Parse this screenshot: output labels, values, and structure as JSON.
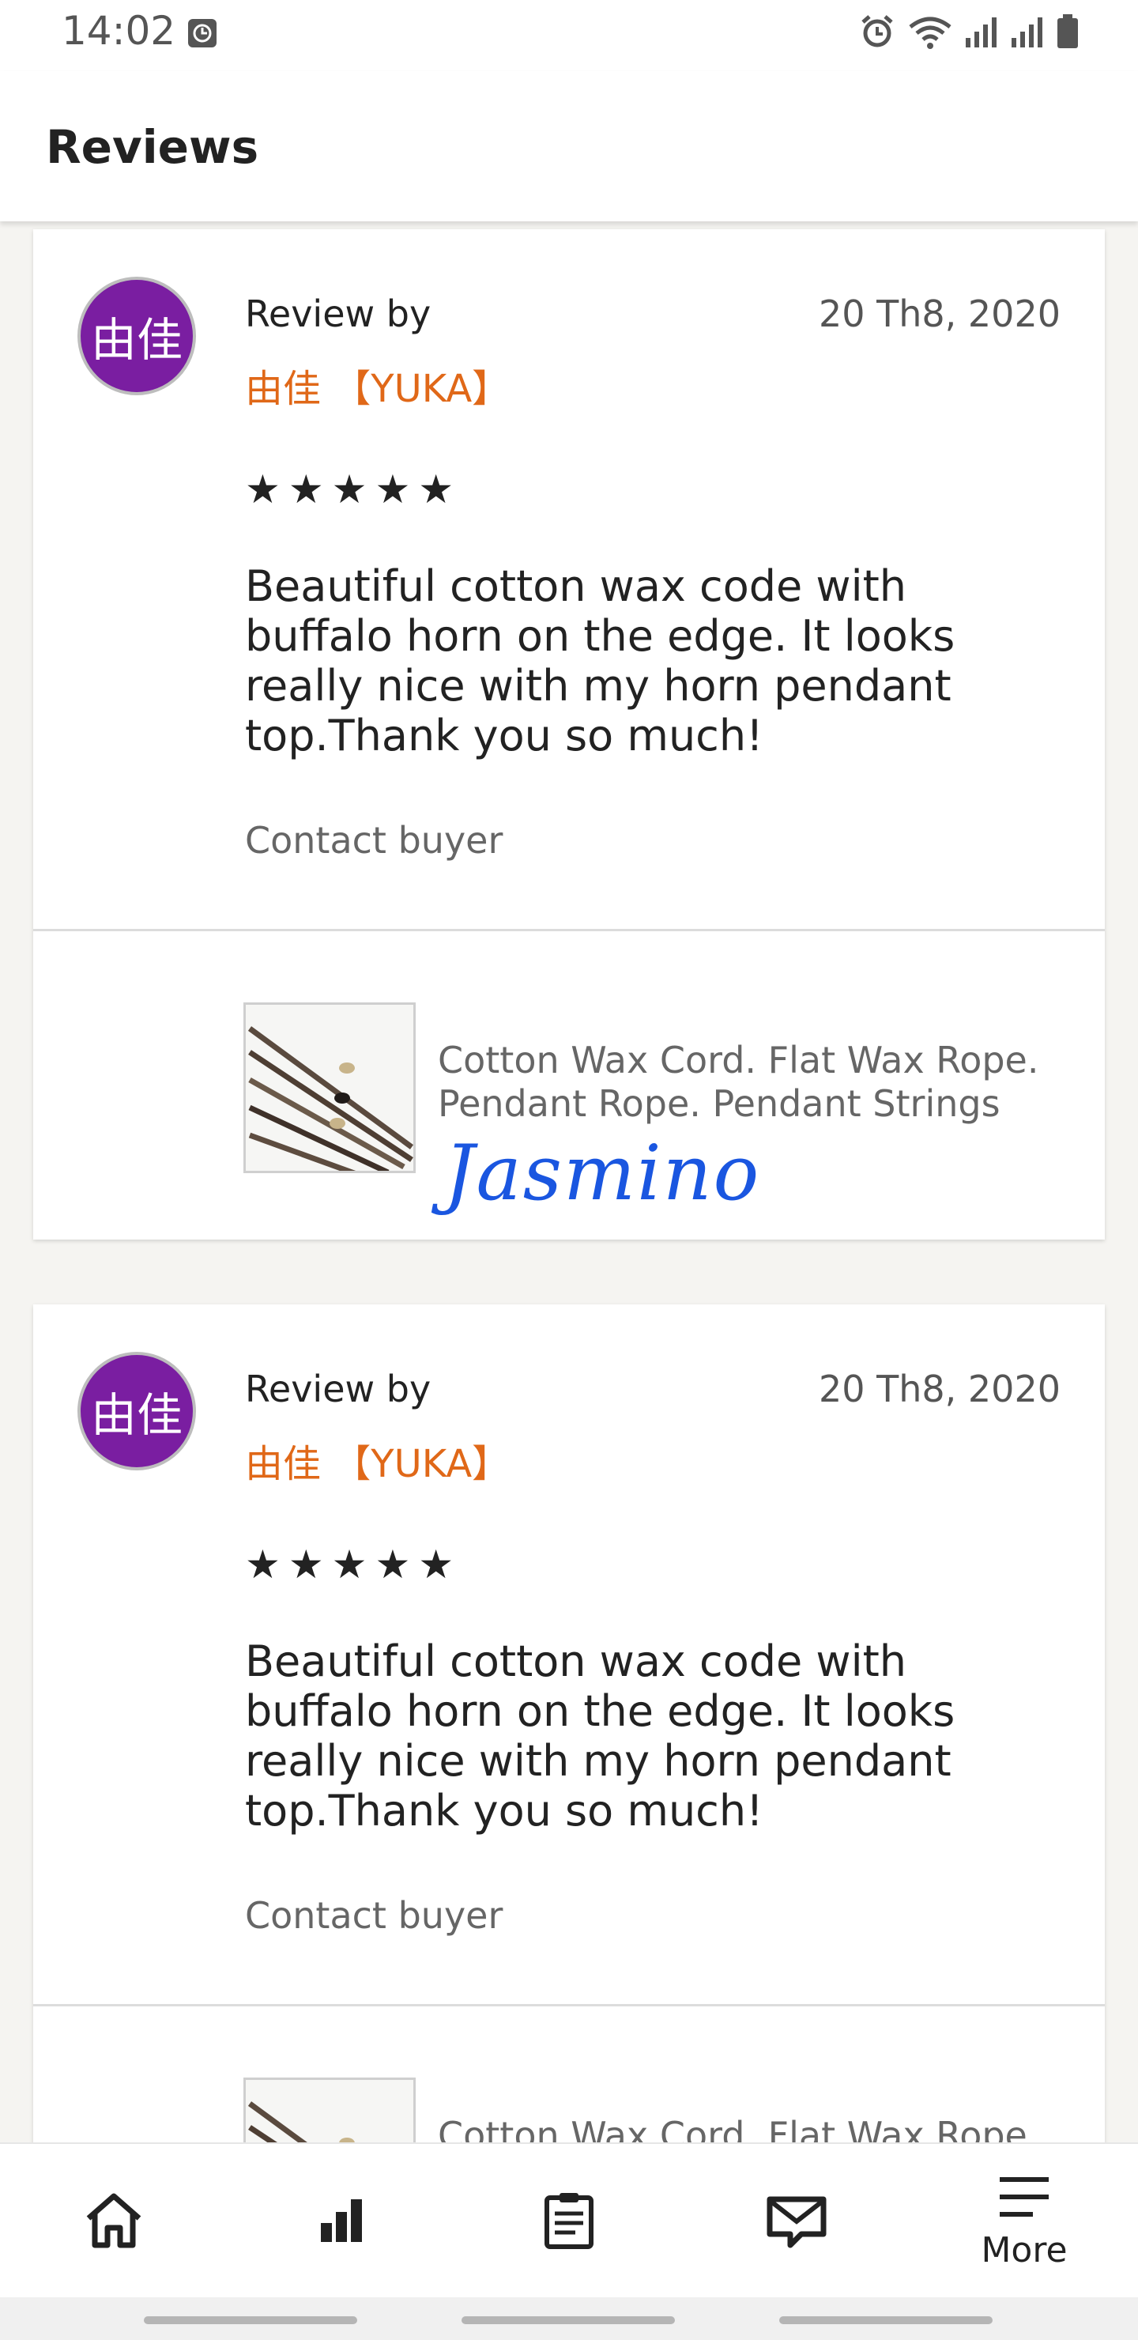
{
  "status_bar": {
    "time": "14:02"
  },
  "header": {
    "title": "Reviews"
  },
  "reviews": [
    {
      "review_by_label": "Review by",
      "avatar_text": "由佳",
      "reviewer": "由佳 【YUKA】",
      "date": "20 Th8, 2020",
      "stars": "★★★★★",
      "rating": 5,
      "text": "Beautiful cotton wax code with buffalo horn on the edge. It looks really nice with my horn pendant top.Thank you so much!",
      "contact_label": "Contact buyer",
      "product_title": "Cotton Wax Cord. Flat Wax Rope. Pendant Rope. Pendant Strings",
      "watermark": "Jasmino"
    },
    {
      "review_by_label": "Review by",
      "avatar_text": "由佳",
      "reviewer": "由佳 【YUKA】",
      "date": "20 Th8, 2020",
      "stars": "★★★★★",
      "rating": 5,
      "text": "Beautiful cotton wax code with buffalo horn on the edge. It looks really nice with my horn pendant top.Thank you so much!",
      "contact_label": "Contact buyer",
      "product_title": "Cotton Wax Cord. Flat Wax Rope. Pendant Rope. Pendant Strings"
    }
  ],
  "bottom_nav": {
    "items": [
      {
        "icon": "home-icon"
      },
      {
        "icon": "stats-icon"
      },
      {
        "icon": "orders-icon"
      },
      {
        "icon": "messages-icon"
      },
      {
        "icon": "menu-icon",
        "label": "More"
      }
    ]
  },
  "colors": {
    "accent": "#e06818",
    "avatar": "#7a1ea1",
    "watermark": "#1a56e0"
  }
}
